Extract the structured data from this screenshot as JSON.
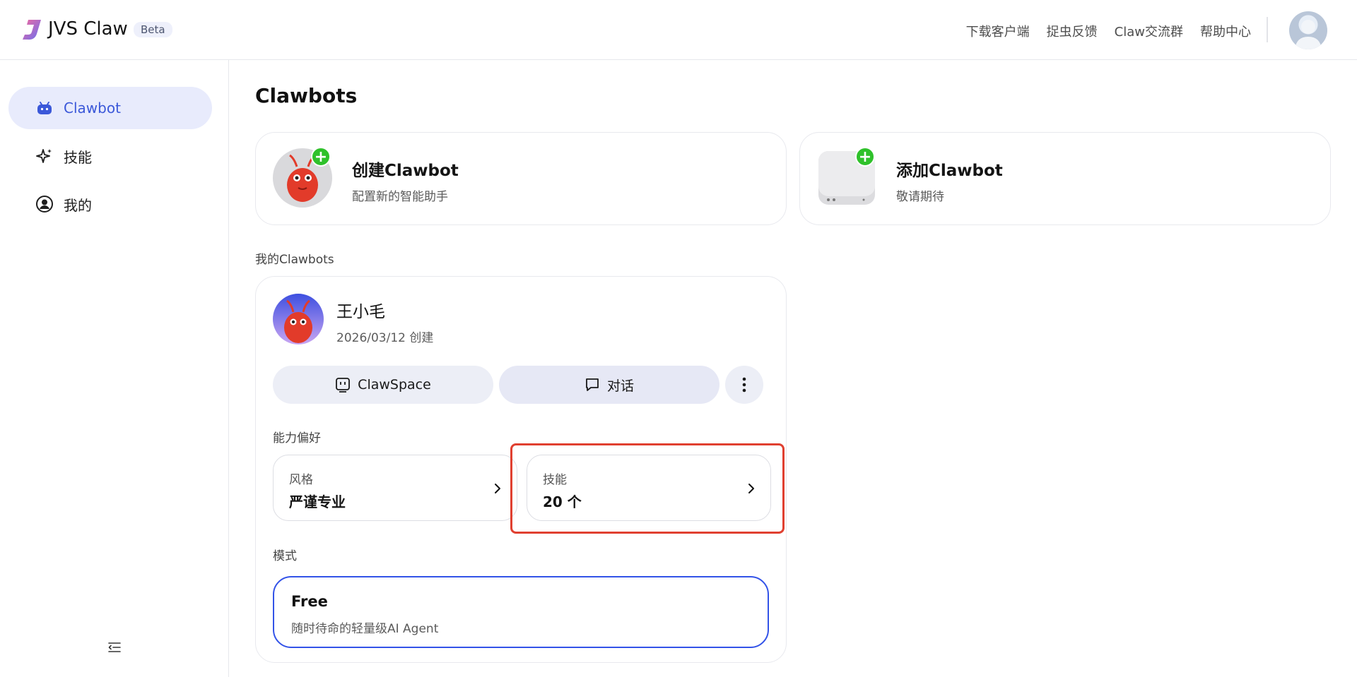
{
  "header": {
    "brand": "JVS Claw",
    "badge": "Beta",
    "nav": [
      "下载客户端",
      "捉虫反馈",
      "Claw交流群",
      "帮助中心"
    ]
  },
  "sidebar": {
    "items": [
      {
        "label": "Clawbot",
        "icon": "robot-icon",
        "active": true
      },
      {
        "label": "技能",
        "icon": "sparkle-icon",
        "active": false
      },
      {
        "label": "我的",
        "icon": "user-circle-icon",
        "active": false
      }
    ]
  },
  "main": {
    "title": "Clawbots",
    "create_card": {
      "title": "创建Clawbot",
      "subtitle": "配置新的智能助手"
    },
    "add_card": {
      "title": "添加Clawbot",
      "subtitle": "敬请期待"
    },
    "my_section": "我的Clawbots",
    "bot": {
      "name": "王小毛",
      "date": "2026/03/12 创建",
      "btn_space": "ClawSpace",
      "btn_chat": "对话",
      "ability_label": "能力偏好",
      "style_label": "风格",
      "style_value": "严谨专业",
      "skill_label": "技能",
      "skill_value": "20 个",
      "mode_label": "模式",
      "mode_title": "Free",
      "mode_subtitle": "随时待命的轻量级AI Agent"
    }
  },
  "colors": {
    "accent": "#3b58d9",
    "active_bg": "#e8ebfc",
    "plus": "#2fc12b",
    "highlight": "#e04030",
    "mode_border": "#3353e8"
  }
}
